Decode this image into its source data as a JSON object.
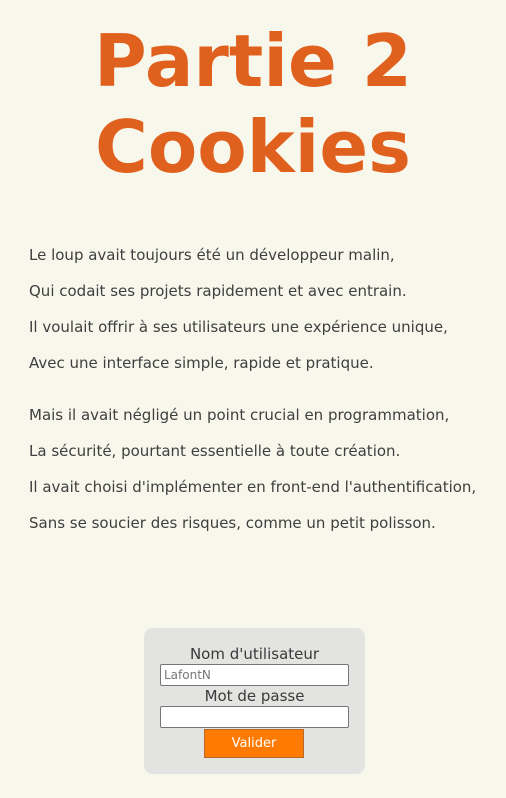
{
  "page": {
    "title_line1": "Partie 2",
    "title_line2": "Cookies"
  },
  "poem": {
    "stanza1": [
      "Le loup avait toujours été un développeur malin,",
      "Qui codait ses projets rapidement et avec entrain.",
      "Il voulait offrir à ses utilisateurs une expérience unique,",
      "Avec une interface simple, rapide et pratique."
    ],
    "stanza2": [
      "Mais il avait négligé un point crucial en programmation,",
      "La sécurité, pourtant essentielle à toute création.",
      "Il avait choisi d'implémenter en front-end l'authentification,",
      "Sans se soucier des risques, comme un petit polisson."
    ]
  },
  "login": {
    "username_label": "Nom d'utilisateur",
    "username_placeholder": "LafontN",
    "username_value": "",
    "password_label": "Mot de passe",
    "password_value": "",
    "submit_label": "Valider"
  },
  "colors": {
    "accent": "#e0611e",
    "button": "#ff7a00",
    "background": "#f8f7ec",
    "form_background": "#e3e3e1"
  }
}
